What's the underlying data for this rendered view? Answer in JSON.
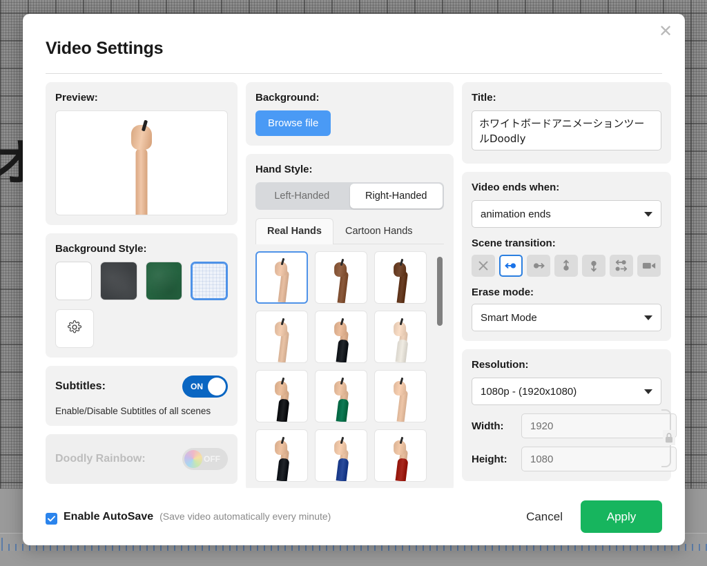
{
  "canvas": {
    "glyph": "オ"
  },
  "modal": {
    "title": "Video Settings",
    "close_label": "✕"
  },
  "preview": {
    "label": "Preview:"
  },
  "background_style": {
    "label": "Background Style:",
    "swatches": [
      {
        "name": "white",
        "color": "#ffffff",
        "selected": false
      },
      {
        "name": "dark-chalkboard",
        "color": "#3d4043",
        "selected": false
      },
      {
        "name": "green-chalkboard",
        "color": "#24623f",
        "selected": false
      },
      {
        "name": "blue-grid",
        "color": "#eef2fa",
        "selected": true
      }
    ],
    "settings_icon": "gear-icon"
  },
  "subtitles": {
    "label": "Subtitles:",
    "state": "ON",
    "description": "Enable/Disable Subtitles of all scenes"
  },
  "rainbow": {
    "label": "Doodly Rainbow:",
    "state": "OFF"
  },
  "background": {
    "label": "Background:",
    "browse_label": "Browse file"
  },
  "hand_style": {
    "label": "Hand Style:",
    "handedness": [
      {
        "label": "Left-Handed",
        "active": false
      },
      {
        "label": "Right-Handed",
        "active": true
      }
    ],
    "tabs": [
      {
        "label": "Real Hands",
        "active": true
      },
      {
        "label": "Cartoon Hands",
        "active": false
      }
    ],
    "hands": [
      {
        "skin": "#e8bfa2",
        "sleeve": "",
        "selected": true
      },
      {
        "skin": "#8b5a3c",
        "sleeve": "",
        "selected": false
      },
      {
        "skin": "#6b4026",
        "sleeve": "",
        "selected": false
      },
      {
        "skin": "#e9c3a6",
        "sleeve": "",
        "selected": false
      },
      {
        "skin": "#e2b493",
        "sleeve": "#22262b",
        "selected": false
      },
      {
        "skin": "#f0d4bd",
        "sleeve": "#f0ece3",
        "selected": false
      },
      {
        "skin": "#e3b795",
        "sleeve": "#1d1f22",
        "selected": false
      },
      {
        "skin": "#e6bc9c",
        "sleeve": "#0e7a55",
        "selected": false
      },
      {
        "skin": "#eec6a8",
        "sleeve": "",
        "selected": false
      },
      {
        "skin": "#e5b998",
        "sleeve": "#20242a",
        "selected": false
      },
      {
        "skin": "#edc5a6",
        "sleeve": "#2a4b9b",
        "selected": false
      },
      {
        "skin": "#e9c0a0",
        "sleeve": "#a8281e",
        "selected": false
      }
    ]
  },
  "title_field": {
    "label": "Title:",
    "value": "ホワイトボードアニメーションツールDoodly"
  },
  "video_ends": {
    "label": "Video ends when:",
    "value": "animation ends"
  },
  "scene_transition": {
    "label": "Scene transition:",
    "options": [
      {
        "icon": "no-transition-icon",
        "selected": false
      },
      {
        "icon": "slide-left-icon",
        "selected": true
      },
      {
        "icon": "slide-right-icon",
        "selected": false
      },
      {
        "icon": "slide-up-icon",
        "selected": false
      },
      {
        "icon": "slide-down-icon",
        "selected": false
      },
      {
        "icon": "crossover-swap-icon",
        "selected": false
      },
      {
        "icon": "video-camera-icon",
        "selected": false
      }
    ]
  },
  "erase_mode": {
    "label": "Erase mode:",
    "value": "Smart Mode"
  },
  "resolution": {
    "label": "Resolution:",
    "value": "1080p  -  (1920x1080)",
    "width_label": "Width:",
    "width_value": "1920",
    "height_label": "Height:",
    "height_value": "1080",
    "lock_icon": "lock-icon"
  },
  "footer": {
    "autosave_label": "Enable AutoSave",
    "autosave_hint": "(Save video automatically every minute)",
    "autosave_checked": true,
    "cancel_label": "Cancel",
    "apply_label": "Apply"
  },
  "colors": {
    "accent_blue": "#4e92e8",
    "primary_blue": "#4a9af5",
    "toggle_on": "#0a66c2",
    "apply_green": "#17b55e",
    "panel_bg": "#f2f2f2"
  }
}
